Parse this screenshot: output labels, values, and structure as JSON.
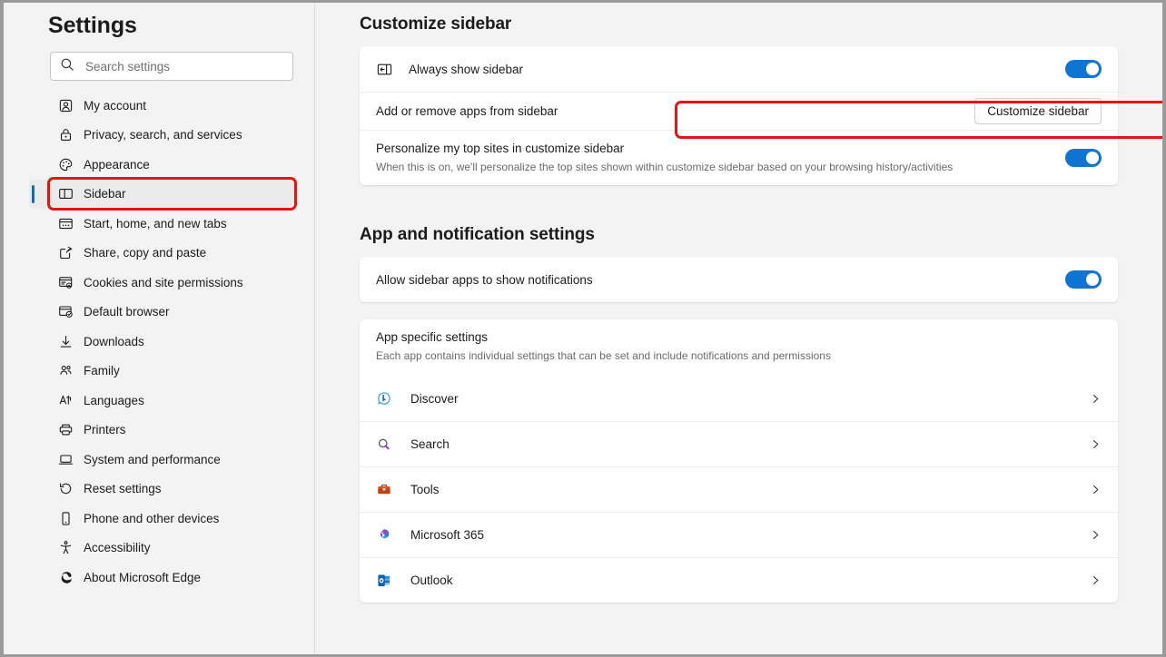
{
  "nav": {
    "title": "Settings",
    "search": {
      "placeholder": "Search settings",
      "value": ""
    },
    "items": [
      {
        "label": "My account",
        "icon": "account-icon",
        "selected": false
      },
      {
        "label": "Privacy, search, and services",
        "icon": "lock-icon",
        "selected": false
      },
      {
        "label": "Appearance",
        "icon": "palette-icon",
        "selected": false
      },
      {
        "label": "Sidebar",
        "icon": "sidebar-icon",
        "selected": true
      },
      {
        "label": "Start, home, and new tabs",
        "icon": "window-icon",
        "selected": false
      },
      {
        "label": "Share, copy and paste",
        "icon": "share-icon",
        "selected": false
      },
      {
        "label": "Cookies and site permissions",
        "icon": "permissions-icon",
        "selected": false
      },
      {
        "label": "Default browser",
        "icon": "default-browser-icon",
        "selected": false
      },
      {
        "label": "Downloads",
        "icon": "download-icon",
        "selected": false
      },
      {
        "label": "Family",
        "icon": "family-icon",
        "selected": false
      },
      {
        "label": "Languages",
        "icon": "languages-icon",
        "selected": false
      },
      {
        "label": "Printers",
        "icon": "printer-icon",
        "selected": false
      },
      {
        "label": "System and performance",
        "icon": "laptop-icon",
        "selected": false
      },
      {
        "label": "Reset settings",
        "icon": "reset-icon",
        "selected": false
      },
      {
        "label": "Phone and other devices",
        "icon": "phone-icon",
        "selected": false
      },
      {
        "label": "Accessibility",
        "icon": "accessibility-icon",
        "selected": false
      },
      {
        "label": "About Microsoft Edge",
        "icon": "edge-icon",
        "selected": false
      }
    ]
  },
  "main": {
    "customize_sidebar": {
      "heading": "Customize sidebar",
      "always_show": {
        "label": "Always show sidebar",
        "icon": "show-sidebar-icon",
        "toggle": "on"
      },
      "add_remove": {
        "label": "Add or remove apps from sidebar",
        "button": "Customize sidebar",
        "highlighted": true
      },
      "personalize": {
        "label": "Personalize my top sites in customize sidebar",
        "description": "When this is on, we'll personalize the top sites shown within customize sidebar based on your browsing history/activities",
        "toggle": "on"
      }
    },
    "app_notifications": {
      "heading": "App and notification settings",
      "allow_notifications": {
        "label": "Allow sidebar apps to show notifications",
        "toggle": "on"
      },
      "app_specific": {
        "label": "App specific settings",
        "description": "Each app contains individual settings that can be set and include notifications and permissions"
      },
      "apps": [
        {
          "label": "Discover",
          "icon": "discover-bing-icon"
        },
        {
          "label": "Search",
          "icon": "search-magnifier-icon"
        },
        {
          "label": "Tools",
          "icon": "tools-toolbox-icon"
        },
        {
          "label": "Microsoft 365",
          "icon": "microsoft-365-icon"
        },
        {
          "label": "Outlook",
          "icon": "outlook-icon"
        }
      ]
    }
  },
  "colors": {
    "accent": "#0f6cbd",
    "toggle_on": "#0f75d4",
    "highlight": "#e81313",
    "pane_bg": "#f3f3f3",
    "card_bg": "#ffffff"
  }
}
